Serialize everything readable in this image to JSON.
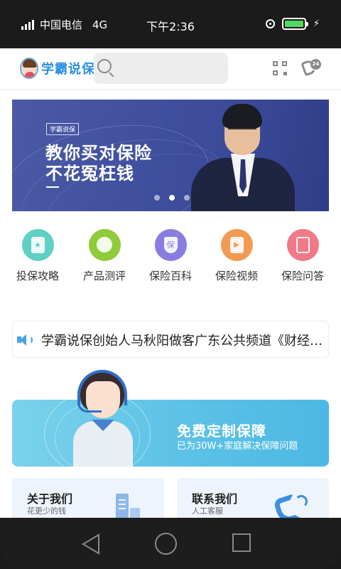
{
  "status_bar": {
    "carrier": "中国电信",
    "network": "4G",
    "time": "下午2:36"
  },
  "header": {
    "app_name": "学霸说保",
    "search_placeholder": ""
  },
  "banner": {
    "tag": "学霸说保",
    "line1": "教你买对保险",
    "line2": "不花冤枉钱",
    "active_dot": 2,
    "dot_count": 3
  },
  "categories": [
    {
      "label": "投保攻略",
      "icon": "star-card-icon",
      "color": "#5fd0c4"
    },
    {
      "label": "产品测评",
      "icon": "chart-icon",
      "color": "#8fcb3a"
    },
    {
      "label": "保险百科",
      "icon": "shield-bao-icon",
      "color": "#8a7de0"
    },
    {
      "label": "保险视频",
      "icon": "video-icon",
      "color": "#f39a52"
    },
    {
      "label": "保险问答",
      "icon": "qa-icon",
      "color": "#f07a88"
    }
  ],
  "notice": {
    "text": "学霸说保创始人马秋阳做客广东公共频道《财经郎眼》"
  },
  "service_banner": {
    "title": "免费定制保障",
    "subtitle": "已为30W+家庭解决保障问题"
  },
  "cards": [
    {
      "title": "关于我们",
      "subtitle": "花更少的钱"
    },
    {
      "title": "联系我们",
      "subtitle": "人工客服"
    }
  ]
}
